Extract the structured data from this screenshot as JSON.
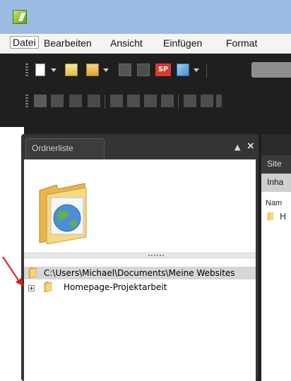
{
  "menubar": {
    "items": [
      "Datei",
      "Bearbeiten",
      "Ansicht",
      "Einfügen",
      "Format"
    ]
  },
  "toolbar": {
    "sp_label": "SP"
  },
  "folder_panel": {
    "tab_label": "Ordnerliste",
    "pin_icon": "pin-icon",
    "close_label": "×",
    "tree": {
      "root_path": "C:\\Users\\Michael\\Documents\\Meine Websites",
      "child_label": "Homepage-Projektarbeit"
    }
  },
  "site_panel": {
    "title": "Site",
    "subheader": "Inha",
    "column_header": "Nam",
    "item_text": "H"
  },
  "colors": {
    "titlebar": "#9bbbe3",
    "toolbar_bg": "#1f1f1f",
    "folder_yellow": "#f2c14e",
    "annotation_arrow": "#e3141b"
  }
}
